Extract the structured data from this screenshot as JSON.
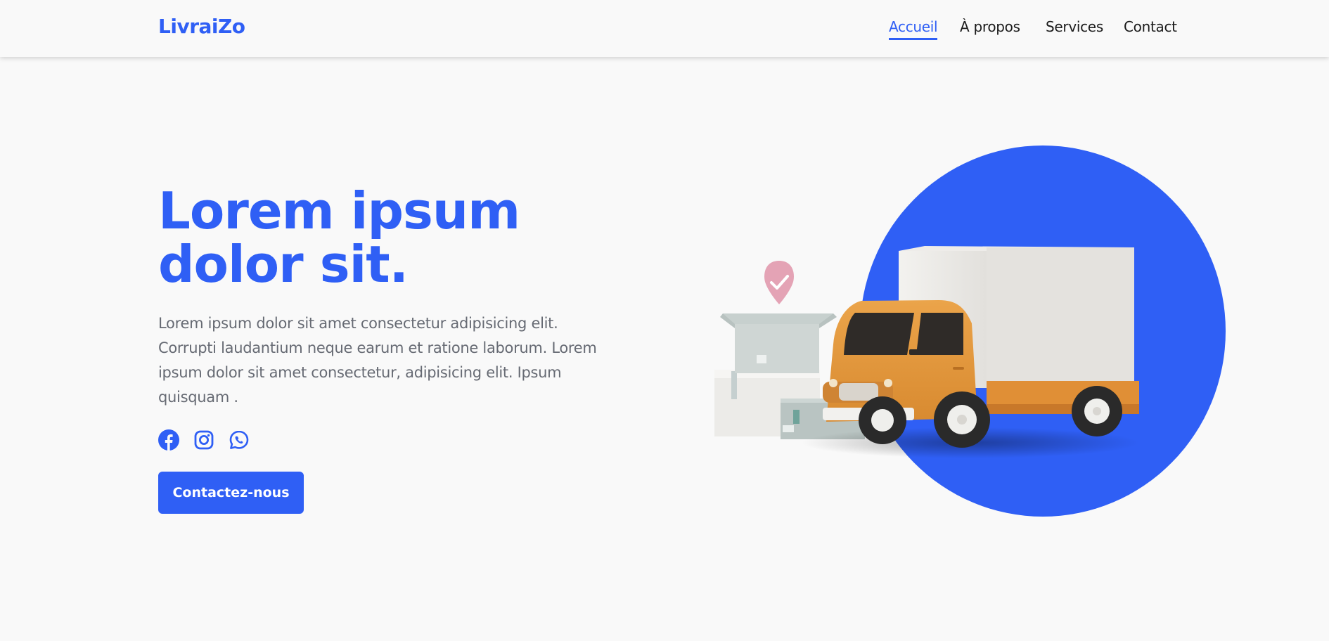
{
  "header": {
    "logo": "LivraiZo",
    "nav": [
      {
        "label": "Accueil",
        "active": true
      },
      {
        "label": "À propos",
        "active": false
      },
      {
        "label": "Services",
        "active": false
      },
      {
        "label": "Contact",
        "active": false
      }
    ]
  },
  "hero": {
    "title_line1": "Lorem ipsum",
    "title_line2": "dolor sit.",
    "description": "Lorem ipsum dolor sit amet consectetur adipisicing elit. Corrupti laudantium neque earum et ratione laborum. Lorem ipsum dolor sit amet consectetur, adipisicing elit. Ipsum quisquam .",
    "socials": [
      {
        "icon": "facebook-icon"
      },
      {
        "icon": "instagram-icon"
      },
      {
        "icon": "whatsapp-icon"
      }
    ],
    "cta_label": "Contactez-nous"
  },
  "colors": {
    "accent": "#2f5ff5",
    "background": "#f9f9f9",
    "text_muted": "#666a73",
    "truck_cab": "#e89a3c",
    "truck_box": "#e8e6e2"
  }
}
